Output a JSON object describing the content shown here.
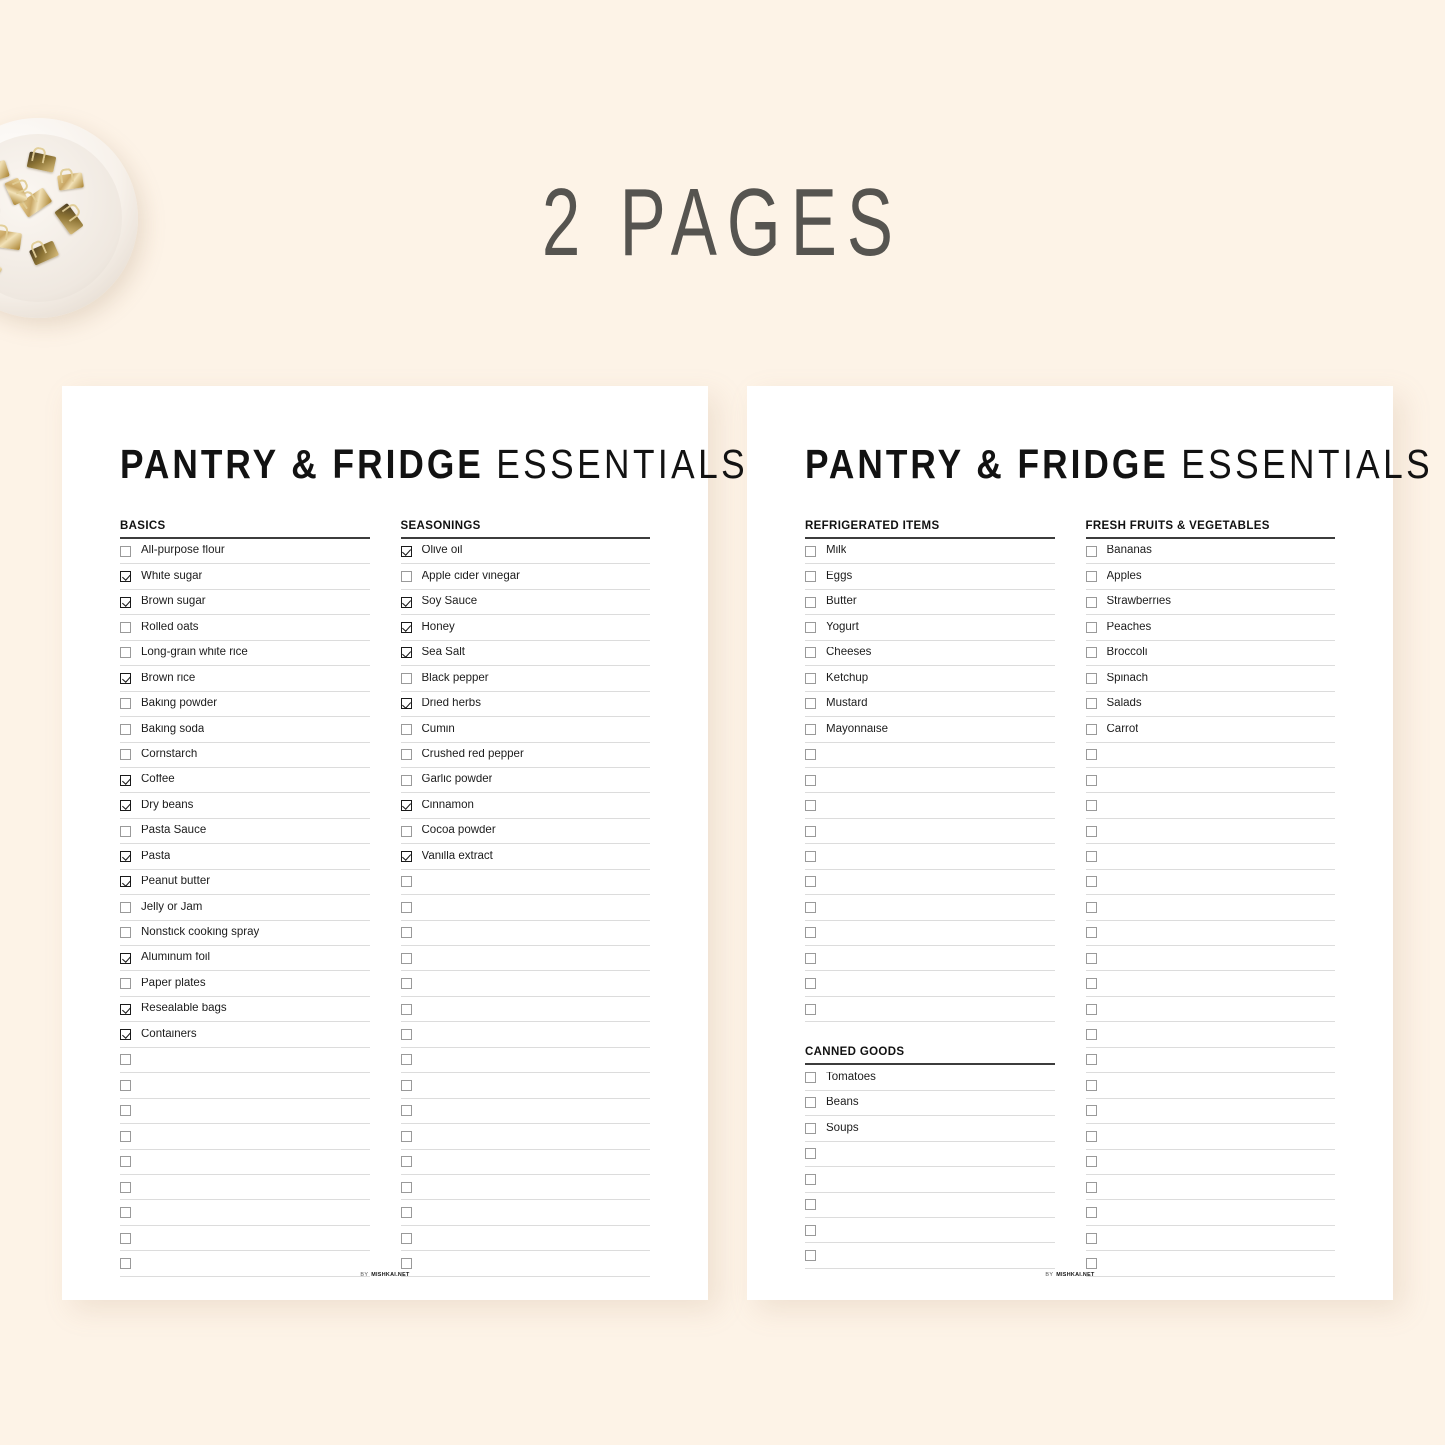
{
  "banner": {
    "title": "2 PAGES"
  },
  "decor": {
    "bowl_name": "bowl-of-gold-binder-clips"
  },
  "colors": {
    "background": "#fdf3e7",
    "sheet": "#ffffff",
    "heading_text": "#565450",
    "title_text": "#121212",
    "rule": "#3c3c3c",
    "row_line": "#dcdcdc",
    "checkbox_border": "#9a9a9a"
  },
  "footer": {
    "by_label": "BY",
    "site": "MISHKAI.NET"
  },
  "pages": [
    {
      "title_bold": "PANTRY & FRIDGE",
      "title_light": "ESSENTIALS",
      "columns": [
        {
          "blocks": [
            {
              "heading": "BASICS",
              "items": [
                {
                  "label": "All-purpose flour",
                  "checked": false
                },
                {
                  "label": "White sugar",
                  "checked": true
                },
                {
                  "label": "Brown sugar",
                  "checked": true
                },
                {
                  "label": "Rolled oats",
                  "checked": false
                },
                {
                  "label": "Long-grain white rice",
                  "checked": false
                },
                {
                  "label": "Brown rice",
                  "checked": true
                },
                {
                  "label": "Baking powder",
                  "checked": false
                },
                {
                  "label": "Baking soda",
                  "checked": false
                },
                {
                  "label": "Cornstarch",
                  "checked": false
                },
                {
                  "label": "Coffee",
                  "checked": true
                },
                {
                  "label": "Dry beans",
                  "checked": true
                },
                {
                  "label": "Pasta Sauce",
                  "checked": false
                },
                {
                  "label": "Pasta",
                  "checked": true
                },
                {
                  "label": "Peanut butter",
                  "checked": true
                },
                {
                  "label": "Jelly or Jam",
                  "checked": false
                },
                {
                  "label": "Nonstick cooking spray",
                  "checked": false
                },
                {
                  "label": "Aluminum foil",
                  "checked": true
                },
                {
                  "label": "Paper plates",
                  "checked": false
                },
                {
                  "label": "Resealable bags",
                  "checked": true
                },
                {
                  "label": "Containers",
                  "checked": true
                },
                {
                  "label": "",
                  "checked": false
                },
                {
                  "label": "",
                  "checked": false
                },
                {
                  "label": "",
                  "checked": false
                },
                {
                  "label": "",
                  "checked": false
                },
                {
                  "label": "",
                  "checked": false
                },
                {
                  "label": "",
                  "checked": false
                },
                {
                  "label": "",
                  "checked": false
                },
                {
                  "label": "",
                  "checked": false
                },
                {
                  "label": "",
                  "checked": false
                }
              ]
            }
          ]
        },
        {
          "blocks": [
            {
              "heading": "SEASONINGS",
              "items": [
                {
                  "label": "Olive oil",
                  "checked": true
                },
                {
                  "label": "Apple cider vinegar",
                  "checked": false
                },
                {
                  "label": "Soy Sauce",
                  "checked": true
                },
                {
                  "label": "Honey",
                  "checked": true
                },
                {
                  "label": "Sea Salt",
                  "checked": true
                },
                {
                  "label": "Black pepper",
                  "checked": false
                },
                {
                  "label": "Dried herbs",
                  "checked": true
                },
                {
                  "label": "Cumin",
                  "checked": false
                },
                {
                  "label": "Crushed red pepper",
                  "checked": false
                },
                {
                  "label": "Garlic powder",
                  "checked": false
                },
                {
                  "label": "Cinnamon",
                  "checked": true
                },
                {
                  "label": "Cocoa powder",
                  "checked": false
                },
                {
                  "label": "Vanilla extract",
                  "checked": true
                },
                {
                  "label": "",
                  "checked": false
                },
                {
                  "label": "",
                  "checked": false
                },
                {
                  "label": "",
                  "checked": false
                },
                {
                  "label": "",
                  "checked": false
                },
                {
                  "label": "",
                  "checked": false
                },
                {
                  "label": "",
                  "checked": false
                },
                {
                  "label": "",
                  "checked": false
                },
                {
                  "label": "",
                  "checked": false
                },
                {
                  "label": "",
                  "checked": false
                },
                {
                  "label": "",
                  "checked": false
                },
                {
                  "label": "",
                  "checked": false
                },
                {
                  "label": "",
                  "checked": false
                },
                {
                  "label": "",
                  "checked": false
                },
                {
                  "label": "",
                  "checked": false
                },
                {
                  "label": "",
                  "checked": false
                },
                {
                  "label": "",
                  "checked": false
                }
              ]
            }
          ]
        }
      ]
    },
    {
      "title_bold": "PANTRY & FRIDGE",
      "title_light": "ESSENTIALS",
      "columns": [
        {
          "blocks": [
            {
              "heading": "REFRIGERATED ITEMS",
              "items": [
                {
                  "label": "Milk",
                  "checked": false
                },
                {
                  "label": "Eggs",
                  "checked": false
                },
                {
                  "label": "Butter",
                  "checked": false
                },
                {
                  "label": "Yogurt",
                  "checked": false
                },
                {
                  "label": "Cheeses",
                  "checked": false
                },
                {
                  "label": "Ketchup",
                  "checked": false
                },
                {
                  "label": "Mustard",
                  "checked": false
                },
                {
                  "label": "Mayonnaise",
                  "checked": false
                },
                {
                  "label": "",
                  "checked": false
                },
                {
                  "label": "",
                  "checked": false
                },
                {
                  "label": "",
                  "checked": false
                },
                {
                  "label": "",
                  "checked": false
                },
                {
                  "label": "",
                  "checked": false
                },
                {
                  "label": "",
                  "checked": false
                },
                {
                  "label": "",
                  "checked": false
                },
                {
                  "label": "",
                  "checked": false
                },
                {
                  "label": "",
                  "checked": false
                },
                {
                  "label": "",
                  "checked": false
                },
                {
                  "label": "",
                  "checked": false
                }
              ]
            },
            {
              "heading": "CANNED GOODS",
              "items": [
                {
                  "label": "Tomatoes",
                  "checked": false
                },
                {
                  "label": "Beans",
                  "checked": false
                },
                {
                  "label": "Soups",
                  "checked": false
                },
                {
                  "label": "",
                  "checked": false
                },
                {
                  "label": "",
                  "checked": false
                },
                {
                  "label": "",
                  "checked": false
                },
                {
                  "label": "",
                  "checked": false
                },
                {
                  "label": "",
                  "checked": false
                }
              ]
            }
          ]
        },
        {
          "blocks": [
            {
              "heading": "FRESH FRUITS & VEGETABLES",
              "items": [
                {
                  "label": "Bananas",
                  "checked": false
                },
                {
                  "label": "Apples",
                  "checked": false
                },
                {
                  "label": "Strawberries",
                  "checked": false
                },
                {
                  "label": "Peaches",
                  "checked": false
                },
                {
                  "label": "Broccoli",
                  "checked": false
                },
                {
                  "label": "Spinach",
                  "checked": false
                },
                {
                  "label": "Salads",
                  "checked": false
                },
                {
                  "label": "Carrot",
                  "checked": false
                },
                {
                  "label": "",
                  "checked": false
                },
                {
                  "label": "",
                  "checked": false
                },
                {
                  "label": "",
                  "checked": false
                },
                {
                  "label": "",
                  "checked": false
                },
                {
                  "label": "",
                  "checked": false
                },
                {
                  "label": "",
                  "checked": false
                },
                {
                  "label": "",
                  "checked": false
                },
                {
                  "label": "",
                  "checked": false
                },
                {
                  "label": "",
                  "checked": false
                },
                {
                  "label": "",
                  "checked": false
                },
                {
                  "label": "",
                  "checked": false
                },
                {
                  "label": "",
                  "checked": false
                },
                {
                  "label": "",
                  "checked": false
                },
                {
                  "label": "",
                  "checked": false
                },
                {
                  "label": "",
                  "checked": false
                },
                {
                  "label": "",
                  "checked": false
                },
                {
                  "label": "",
                  "checked": false
                },
                {
                  "label": "",
                  "checked": false
                },
                {
                  "label": "",
                  "checked": false
                },
                {
                  "label": "",
                  "checked": false
                },
                {
                  "label": "",
                  "checked": false
                }
              ]
            }
          ]
        }
      ]
    }
  ]
}
